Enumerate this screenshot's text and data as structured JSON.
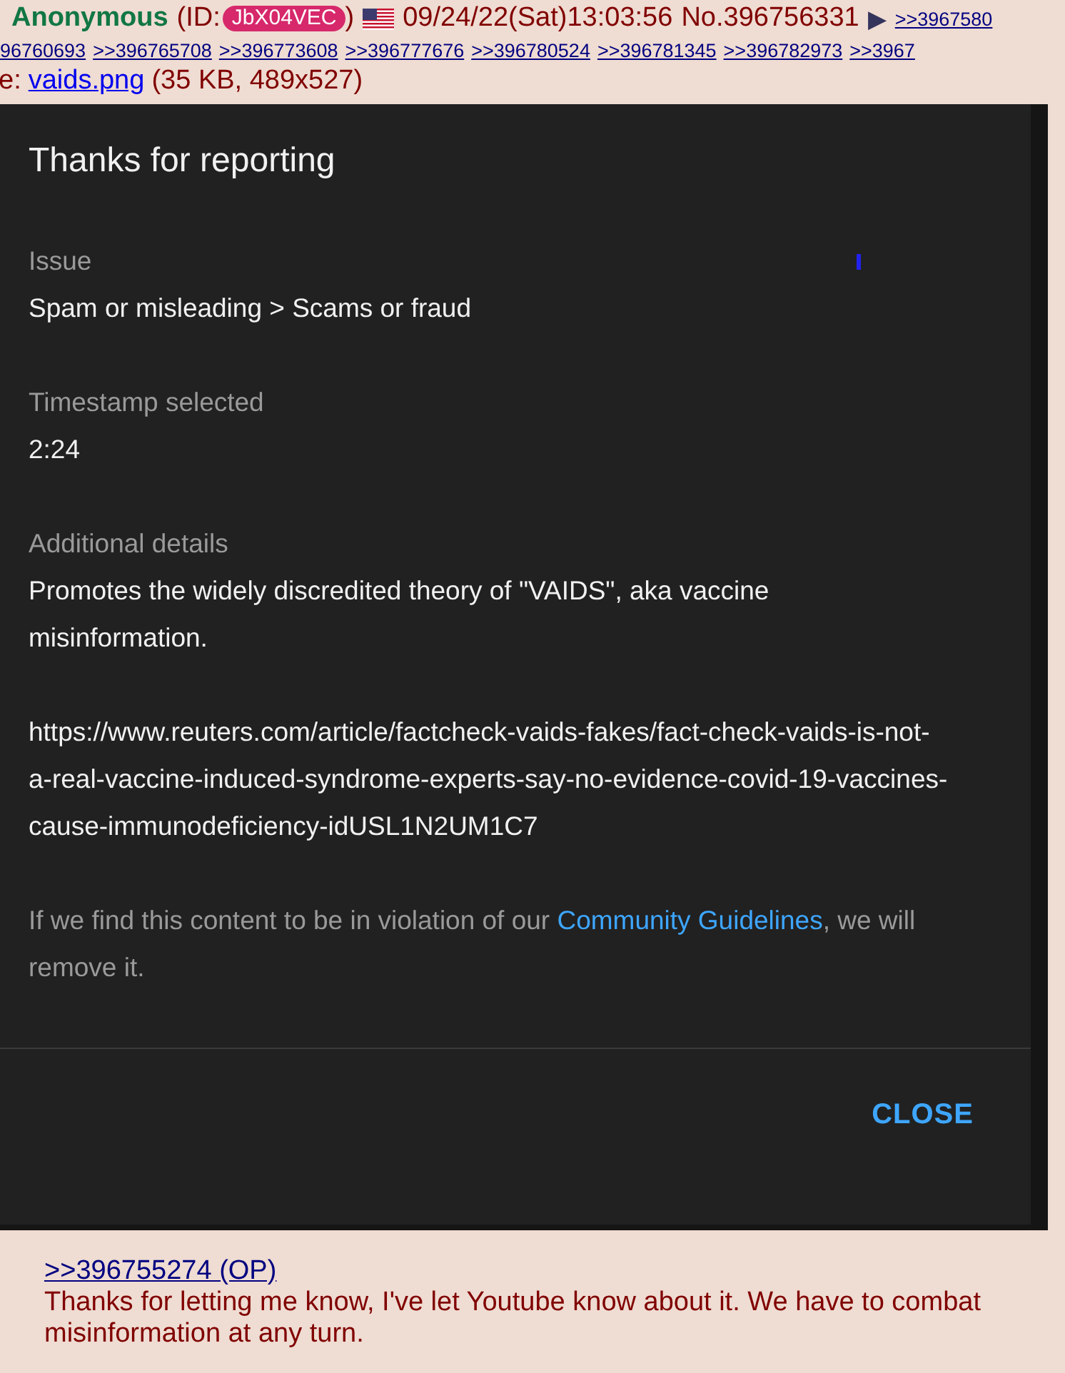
{
  "post": {
    "name": "Anonymous",
    "id_label": "(ID:",
    "id": "JbX04VEC",
    "id_close": ")",
    "datetime": "09/24/22(Sat)13:03:56",
    "number": "No.396756331",
    "menu_arrow": "▶",
    "first_backlink": ">>3967580",
    "backlinks": [
      "96760693",
      ">>396765708",
      ">>396773608",
      ">>396777676",
      ">>396780524",
      ">>396781345",
      ">>396782973",
      ">>3967"
    ],
    "file": {
      "prefix": "e:",
      "name": "vaids.png",
      "info": "(35 KB, 489x527)"
    },
    "image": {
      "dialog": {
        "title": "Thanks for reporting",
        "fields": [
          {
            "label": "Issue",
            "value": "Spam or misleading > Scams or fraud"
          },
          {
            "label": "Timestamp selected",
            "value": "2:24"
          },
          {
            "label": "Additional details",
            "paragraphs": [
              "Promotes the widely discredited theory of \"VAIDS\", aka vaccine misinformation.",
              "https://www.reuters.com/article/factcheck-vaids-fakes/fact-check-vaids-is-not-a-real-vaccine-induced-syndrome-experts-say-no-evidence-covid-19-vaccines-cause-immunodeficiency-idUSL1N2UM1C7"
            ]
          }
        ],
        "footer": {
          "before": "If we find this content to be in violation of our ",
          "link": "Community Guidelines",
          "after": ", we will remove it."
        },
        "button": "CLOSE"
      }
    },
    "reply": {
      "quote": ">>396755274 (OP)",
      "text": "Thanks for letting me know, I've let Youtube know about it. We have to combat misinformation at any turn."
    }
  }
}
